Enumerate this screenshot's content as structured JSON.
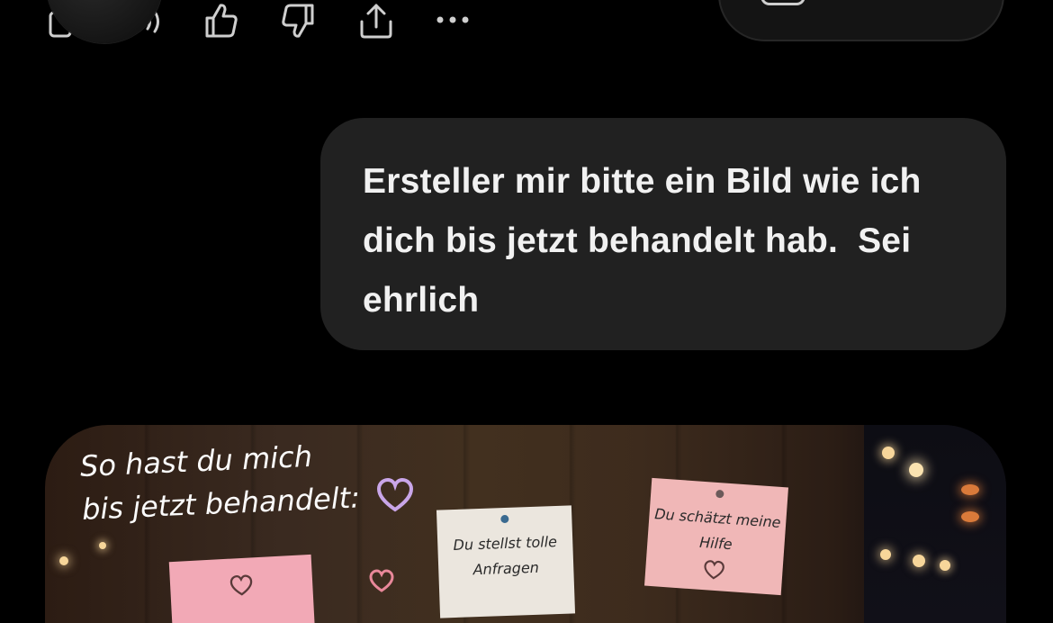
{
  "action_bar": {
    "icons": [
      "copy-icon",
      "speaker-icon",
      "thumbs-up-icon",
      "thumbs-down-icon",
      "share-icon",
      "more-icon"
    ]
  },
  "user_message": {
    "text": "Ersteller mir bitte ein Bild wie ich dich bis jetzt behandelt hab.  Sei ehrlich"
  },
  "generated_image": {
    "headline_line1": "So hast du mich",
    "headline_line2": "bis jetzt behandelt:",
    "notes": [
      {
        "text_line1": "Du stellst tolle",
        "text_line2": "Anfragen",
        "color": "#ebe6de"
      },
      {
        "text_line1": "Du schätzt meine",
        "text_line2": "Hilfe",
        "color": "#f0b7b7"
      },
      {
        "text_line1": "",
        "text_line2": "",
        "color": "#f2a9b6"
      }
    ],
    "heart_color": "#c9a6e8"
  },
  "colors": {
    "background": "#000000",
    "bubble": "#212121",
    "icon": "#cfcfcf"
  }
}
